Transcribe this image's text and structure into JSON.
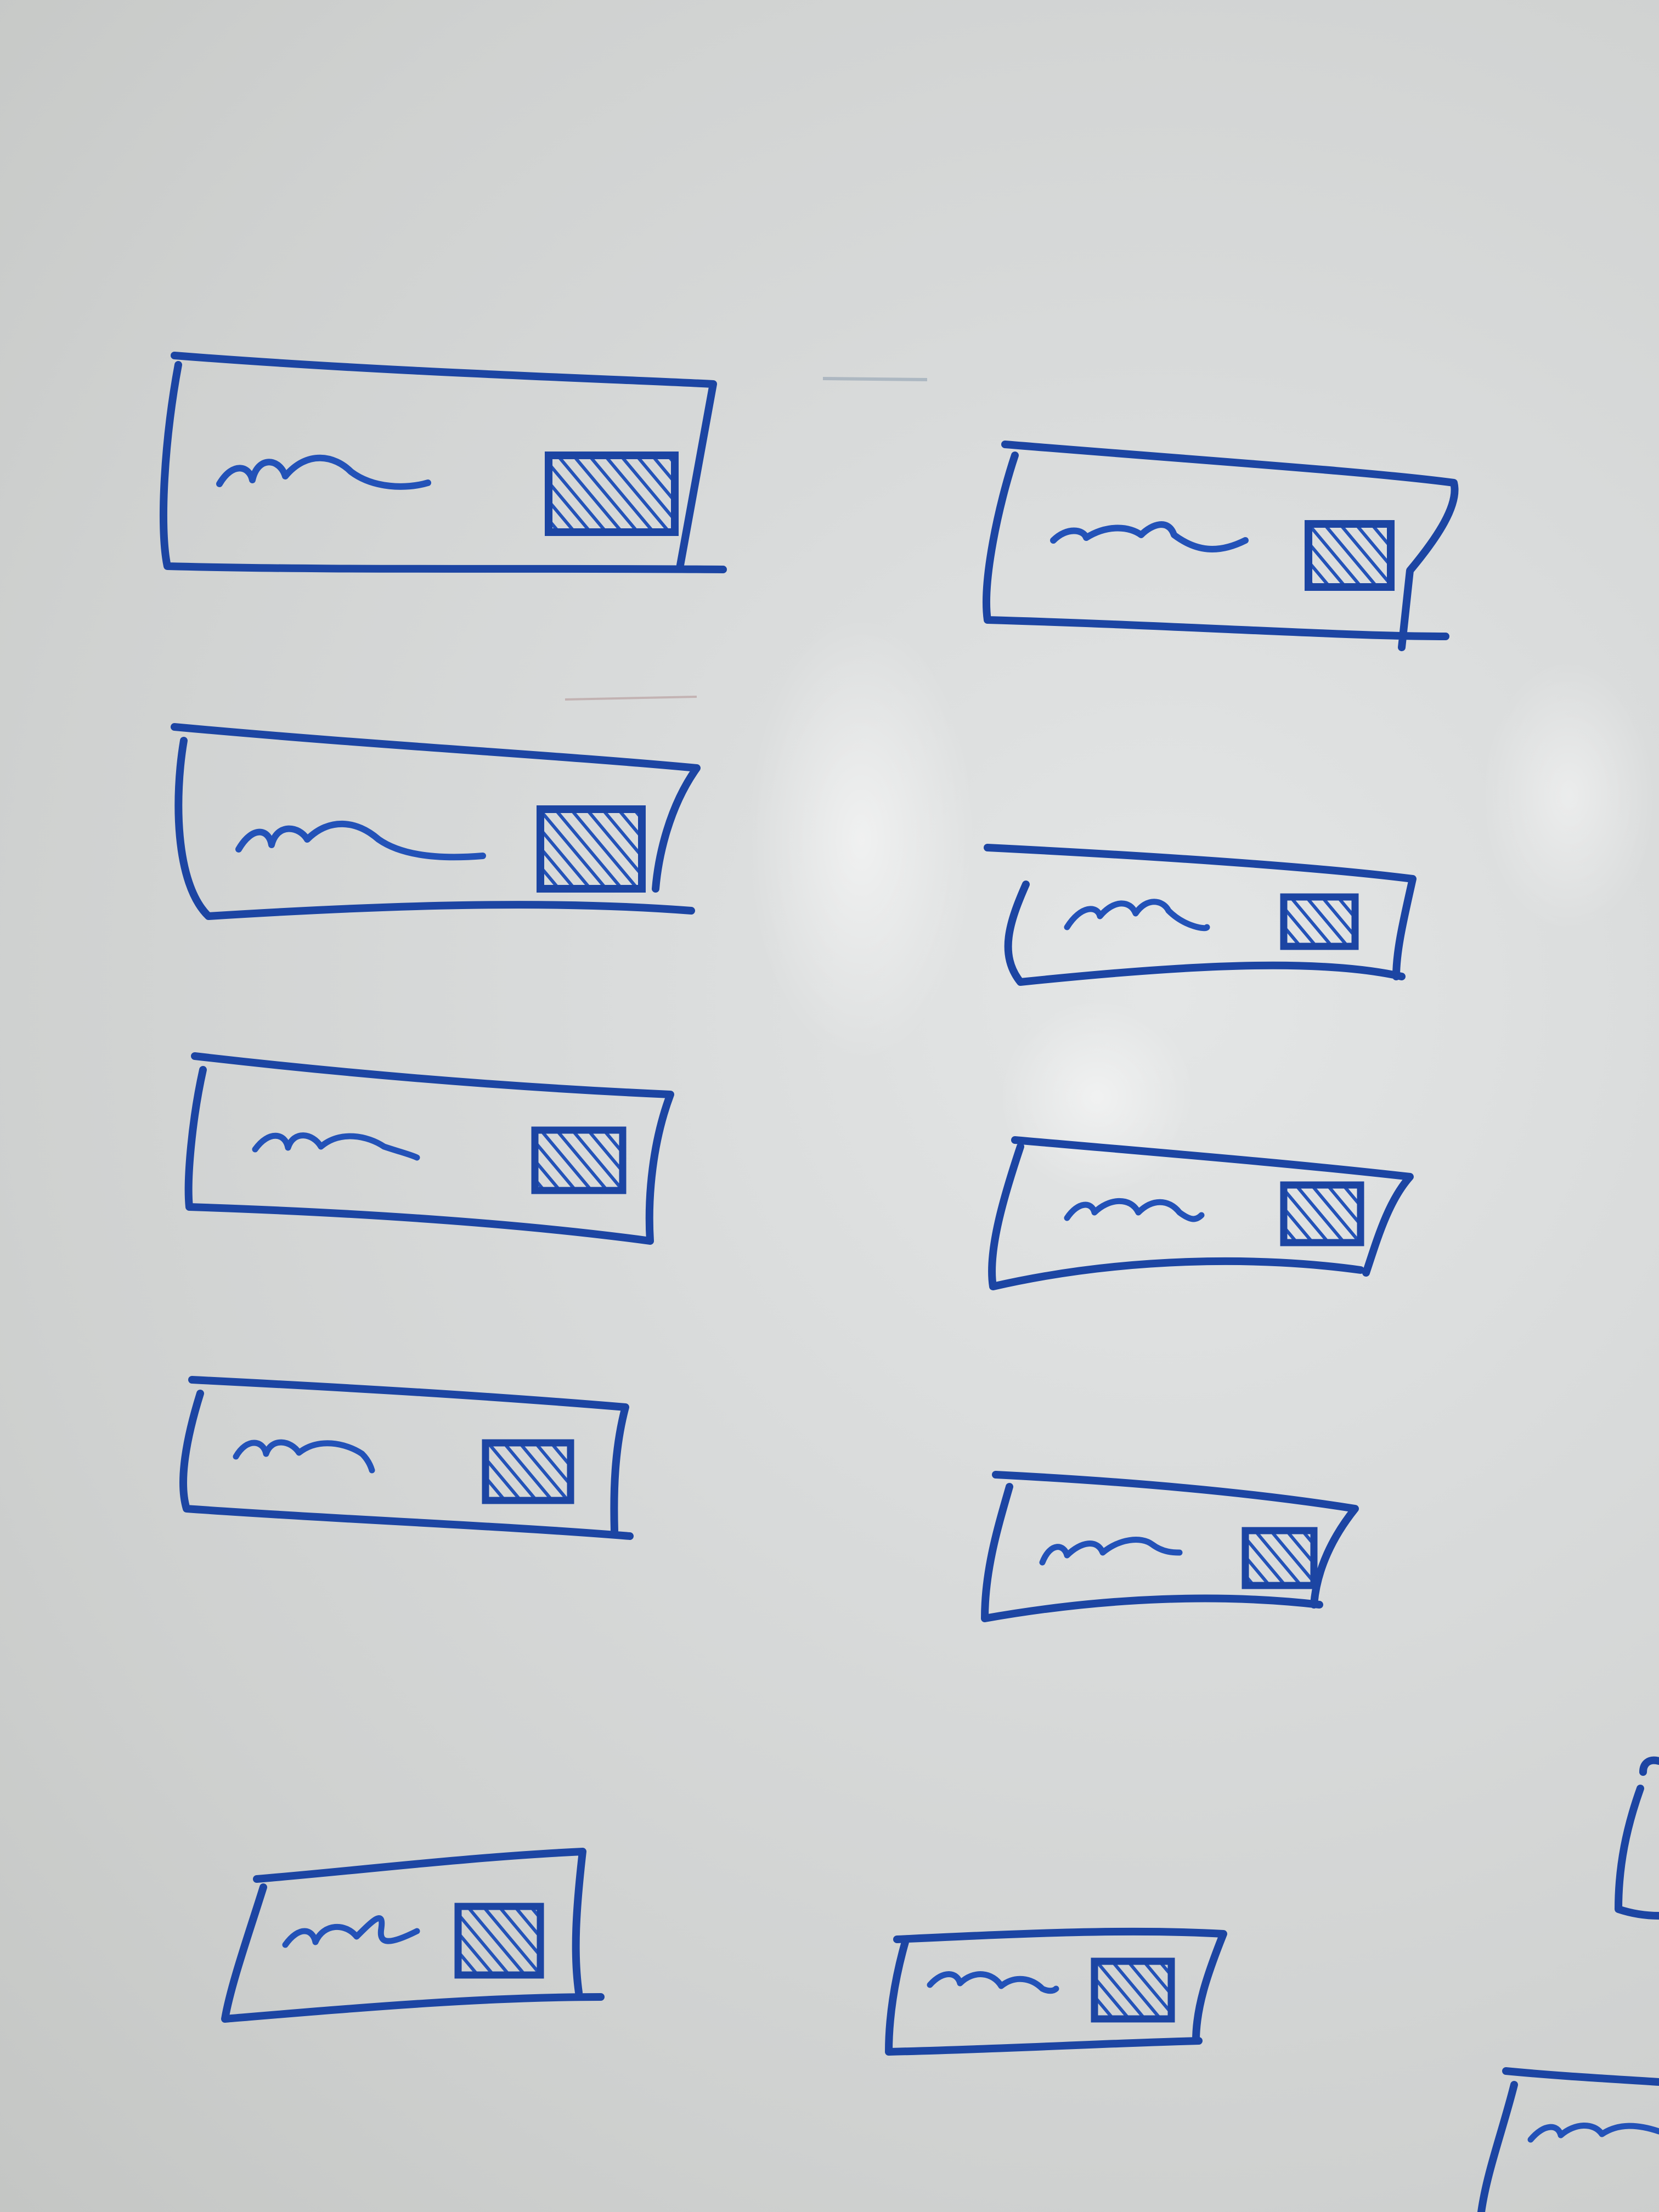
{
  "scene": {
    "surface": "whiteboard",
    "surface_color": "#d8dada",
    "ink_color": "#2352b8",
    "ink_dark": "#1c45a3"
  },
  "sketches": {
    "left_column_count": 5,
    "right_column_count": 5,
    "partial_edge_count": 2,
    "element_parts": [
      "text-squiggle",
      "image-placeholder"
    ]
  }
}
